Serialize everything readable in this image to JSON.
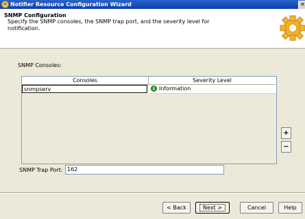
{
  "window": {
    "title": "Notifier Resource Configuration Wizard",
    "close_glyph": "✕"
  },
  "header": {
    "title": "SNMP Configuration",
    "description": "Specify the SNMP consoles, the SNMP trap port, and the severity level for notification."
  },
  "consoles_label": "SNMP Consoles:",
  "table": {
    "columns": [
      "Consoles",
      "Severity Level"
    ],
    "rows": [
      {
        "console": "snmpserv",
        "severity": "Information",
        "severity_icon": "information-icon"
      }
    ]
  },
  "side_buttons": {
    "add": "+",
    "remove": "−"
  },
  "trap_port": {
    "label": "SNMP Trap Port:",
    "value": "162"
  },
  "buttons": {
    "back": "< Back",
    "next": "Next >",
    "cancel": "Cancel",
    "help": "Help"
  },
  "colors": {
    "titlebar": "#0b3fae",
    "dialog_bg": "#ece9d8",
    "severity_info": "#2f9e2f"
  }
}
